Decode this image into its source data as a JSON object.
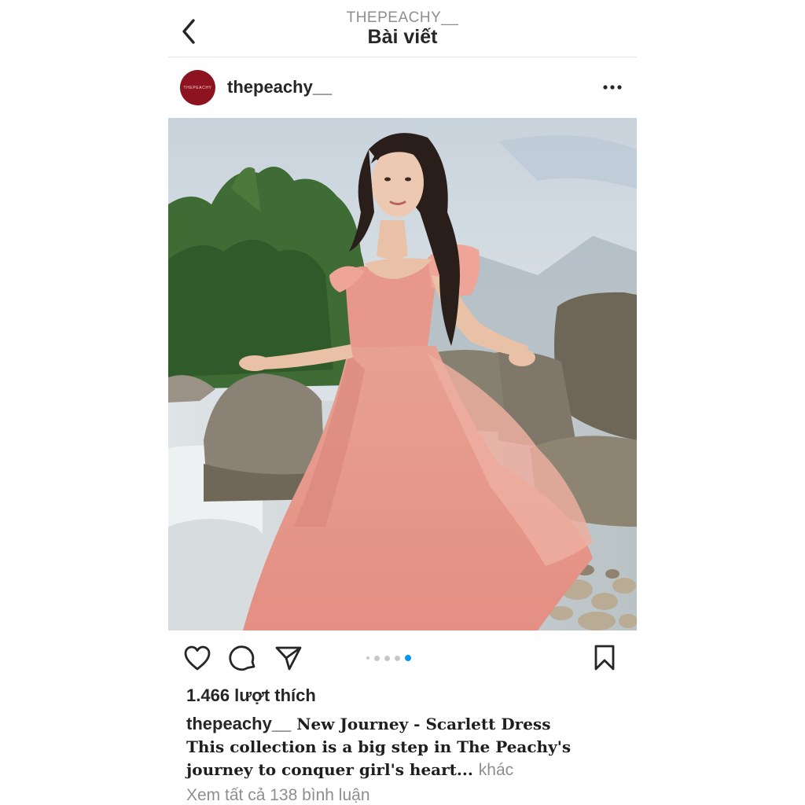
{
  "header": {
    "account": "THEPEACHY__",
    "title": "Bài viết",
    "back_icon": "chevron-left-icon"
  },
  "post": {
    "username": "thepeachy__",
    "avatar_text": "THEPEACHY",
    "avatar_color": "#8e1320",
    "more_icon": "ellipsis-horizontal-icon",
    "image_description_icon": "photo",
    "carousel": {
      "count": 5,
      "active_index": 4
    },
    "likes": "1.466 lượt thích",
    "caption_line1": "New Journey - Scarlett Dress",
    "caption_line2": "This collection is a big step in The Peachy's",
    "caption_line3": "journey to conquer girl's heart...",
    "more_label": "khác",
    "comments_link": "Xem tất cả 138 bình luận"
  },
  "colors": {
    "accent": "#0095f6",
    "text": "#262626",
    "muted": "#8e8e8e",
    "dress": "#e99a8e"
  }
}
